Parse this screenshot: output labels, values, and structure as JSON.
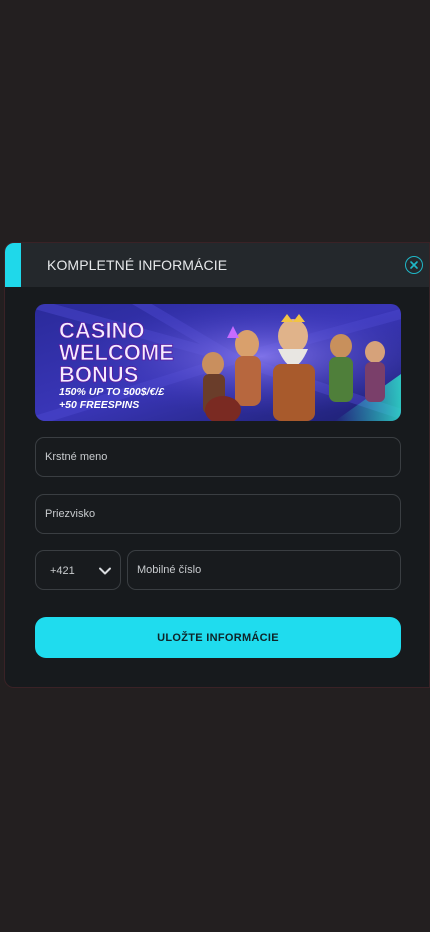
{
  "modal": {
    "title": "KOMPLETNÉ INFORMÁCIE",
    "banner": {
      "line1": "CASINO",
      "line2": "WELCOME",
      "line3": "BONUS",
      "offer": "150% UP TO 500$/€/£",
      "spins": "+50 FREESPINS"
    },
    "first_name_placeholder": "Krstné meno",
    "last_name_placeholder": "Priezvisko",
    "phone_prefix": "+421",
    "phone_placeholder": "Mobilné číslo",
    "save_label": "ULOŽTE INFORMÁCIE"
  },
  "colors": {
    "accent": "#1fdcee",
    "modal_bg": "#171a1d",
    "header_bg": "#24282c"
  },
  "icons": [
    "close-circle-icon",
    "chevron-down-icon"
  ]
}
